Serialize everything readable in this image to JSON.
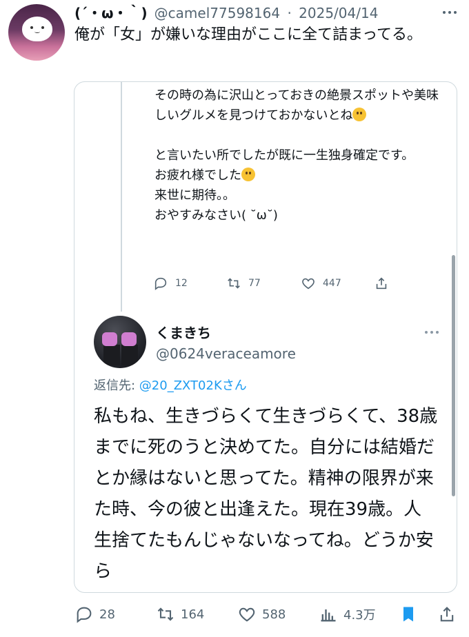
{
  "tweet": {
    "display_name": "(´・ω・｀)",
    "handle": "@camel77598164",
    "separator": "·",
    "date": "2025/04/14",
    "text": "俺が「女」が嫌いな理由がここに全て詰まってる。"
  },
  "quoted_upper": {
    "line1": "その時の為に沢山とっておきの絶景スポットや美味しいグルメを見つけておかないとね",
    "line2": "と言いたい所でしたが既に一生独身確定です。",
    "line3": "お疲れ様でした",
    "line4": "来世に期待。。",
    "line5": "おやすみなさい( ˘ω˘)",
    "stats": {
      "replies": "12",
      "retweets": "77",
      "likes": "447"
    }
  },
  "quoted_reply": {
    "name": "くまきち",
    "handle": "@0624veraceamore",
    "reply_to_label": "返信先: ",
    "reply_to_handle": "@20_ZXT02Kさん",
    "body": "私もね、生きづらくて生きづらくて、38歳までに死のうと決めてた。自分には結婚だとか縁はないと思ってた。精神の限界が来た時、今の彼と出逢えた。現在39歳。人生捨てたもんじゃないなってね。どうか安ら"
  },
  "actions": {
    "replies": "28",
    "retweets": "164",
    "likes": "588",
    "views": "4.3万"
  },
  "icons": {
    "reply": "reply-icon",
    "retweet": "retweet-icon",
    "like": "heart-icon",
    "views": "views-icon",
    "bookmark": "bookmark-icon",
    "share": "share-icon"
  },
  "colors": {
    "accent": "#1d9bf0",
    "muted": "#536471",
    "border": "#cfd9de"
  }
}
